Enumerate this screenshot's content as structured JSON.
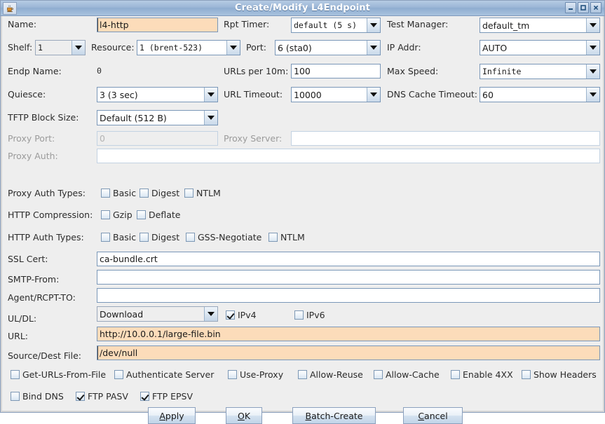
{
  "window": {
    "title": "Create/Modify L4Endpoint",
    "icon": "java-coffee-cup-icon",
    "minimize": "–",
    "maximize": "□",
    "close": "✕"
  },
  "colors": {
    "title_bar": "#9bb6d6",
    "modified_field": "#fcdcba",
    "panel": "#eeeeee",
    "field_border": "#7a97b8",
    "disabled_text": "#9b9b9b"
  },
  "fields": {
    "name": {
      "label": "Name:",
      "value": "l4-http"
    },
    "rpt_timer": {
      "label": "Rpt Timer:",
      "value": "default (5 s)"
    },
    "test_manager": {
      "label": "Test Manager:",
      "value": "default_tm"
    },
    "shelf": {
      "label": "Shelf:",
      "value": "1"
    },
    "resource": {
      "label": "Resource:",
      "value": "1 (brent-523)"
    },
    "port": {
      "label": "Port:",
      "value": "6 (sta0)"
    },
    "ip_addr": {
      "label": "IP Addr:",
      "value": "AUTO"
    },
    "endp_name": {
      "label": "Endp Name:",
      "value": "0"
    },
    "urls_per_10m": {
      "label": "URLs per 10m:",
      "value": "100"
    },
    "max_speed": {
      "label": "Max Speed:",
      "value": "Infinite"
    },
    "quiesce": {
      "label": "Quiesce:",
      "value": "3 (3 sec)"
    },
    "url_timeout": {
      "label": "URL Timeout:",
      "value": "10000"
    },
    "dns_cache_timeout": {
      "label": "DNS Cache Timeout:",
      "value": "60"
    },
    "tftp_block_size": {
      "label": "TFTP Block Size:",
      "value": "Default (512 B)"
    },
    "proxy_port": {
      "label": "Proxy Port:",
      "value": "0"
    },
    "proxy_server": {
      "label": "Proxy Server:",
      "value": ""
    },
    "proxy_auth": {
      "label": "Proxy Auth:",
      "value": ""
    },
    "ssl_cert": {
      "label": "SSL Cert:",
      "value": "ca-bundle.crt"
    },
    "smtp_from": {
      "label": "SMTP-From:",
      "value": ""
    },
    "agent_rcpt_to": {
      "label": "Agent/RCPT-TO:",
      "value": ""
    },
    "ul_dl": {
      "label": "UL/DL:",
      "value": "Download"
    },
    "url": {
      "label": "URL:",
      "value": "http://10.0.0.1/large-file.bin"
    },
    "source_dest_file": {
      "label": "Source/Dest File:",
      "value": "/dev/null"
    }
  },
  "check_groups": {
    "proxy_auth_types": {
      "label": "Proxy Auth Types:",
      "items": [
        {
          "label": "Basic",
          "checked": false
        },
        {
          "label": "Digest",
          "checked": false
        },
        {
          "label": "NTLM",
          "checked": false
        }
      ]
    },
    "http_compression": {
      "label": "HTTP Compression:",
      "items": [
        {
          "label": "Gzip",
          "checked": false
        },
        {
          "label": "Deflate",
          "checked": false
        }
      ]
    },
    "http_auth_types": {
      "label": "HTTP Auth Types:",
      "items": [
        {
          "label": "Basic",
          "checked": false
        },
        {
          "label": "Digest",
          "checked": false
        },
        {
          "label": "GSS-Negotiate",
          "checked": false
        },
        {
          "label": "NTLM",
          "checked": false
        }
      ]
    }
  },
  "ip_version": [
    {
      "label": "IPv4",
      "checked": true
    },
    {
      "label": "IPv6",
      "checked": false
    }
  ],
  "options_row_1": [
    {
      "label": "Get-URLs-From-File",
      "checked": false
    },
    {
      "label": "Authenticate Server",
      "checked": false
    },
    {
      "label": "Use-Proxy",
      "checked": false
    },
    {
      "label": "Allow-Reuse",
      "checked": false
    },
    {
      "label": "Allow-Cache",
      "checked": false
    },
    {
      "label": "Enable 4XX",
      "checked": false
    },
    {
      "label": "Show Headers",
      "checked": false
    }
  ],
  "options_row_2": [
    {
      "label": "Bind DNS",
      "checked": false
    },
    {
      "label": "FTP PASV",
      "checked": true
    },
    {
      "label": "FTP EPSV",
      "checked": true
    }
  ],
  "buttons": [
    {
      "name": "apply",
      "mnemonic": "A",
      "rest": "pply"
    },
    {
      "name": "ok",
      "mnemonic": "O",
      "rest": "K"
    },
    {
      "name": "batch-create",
      "mnemonic": "B",
      "rest": "atch-Create"
    },
    {
      "name": "cancel",
      "mnemonic": "C",
      "rest": "ancel"
    }
  ]
}
